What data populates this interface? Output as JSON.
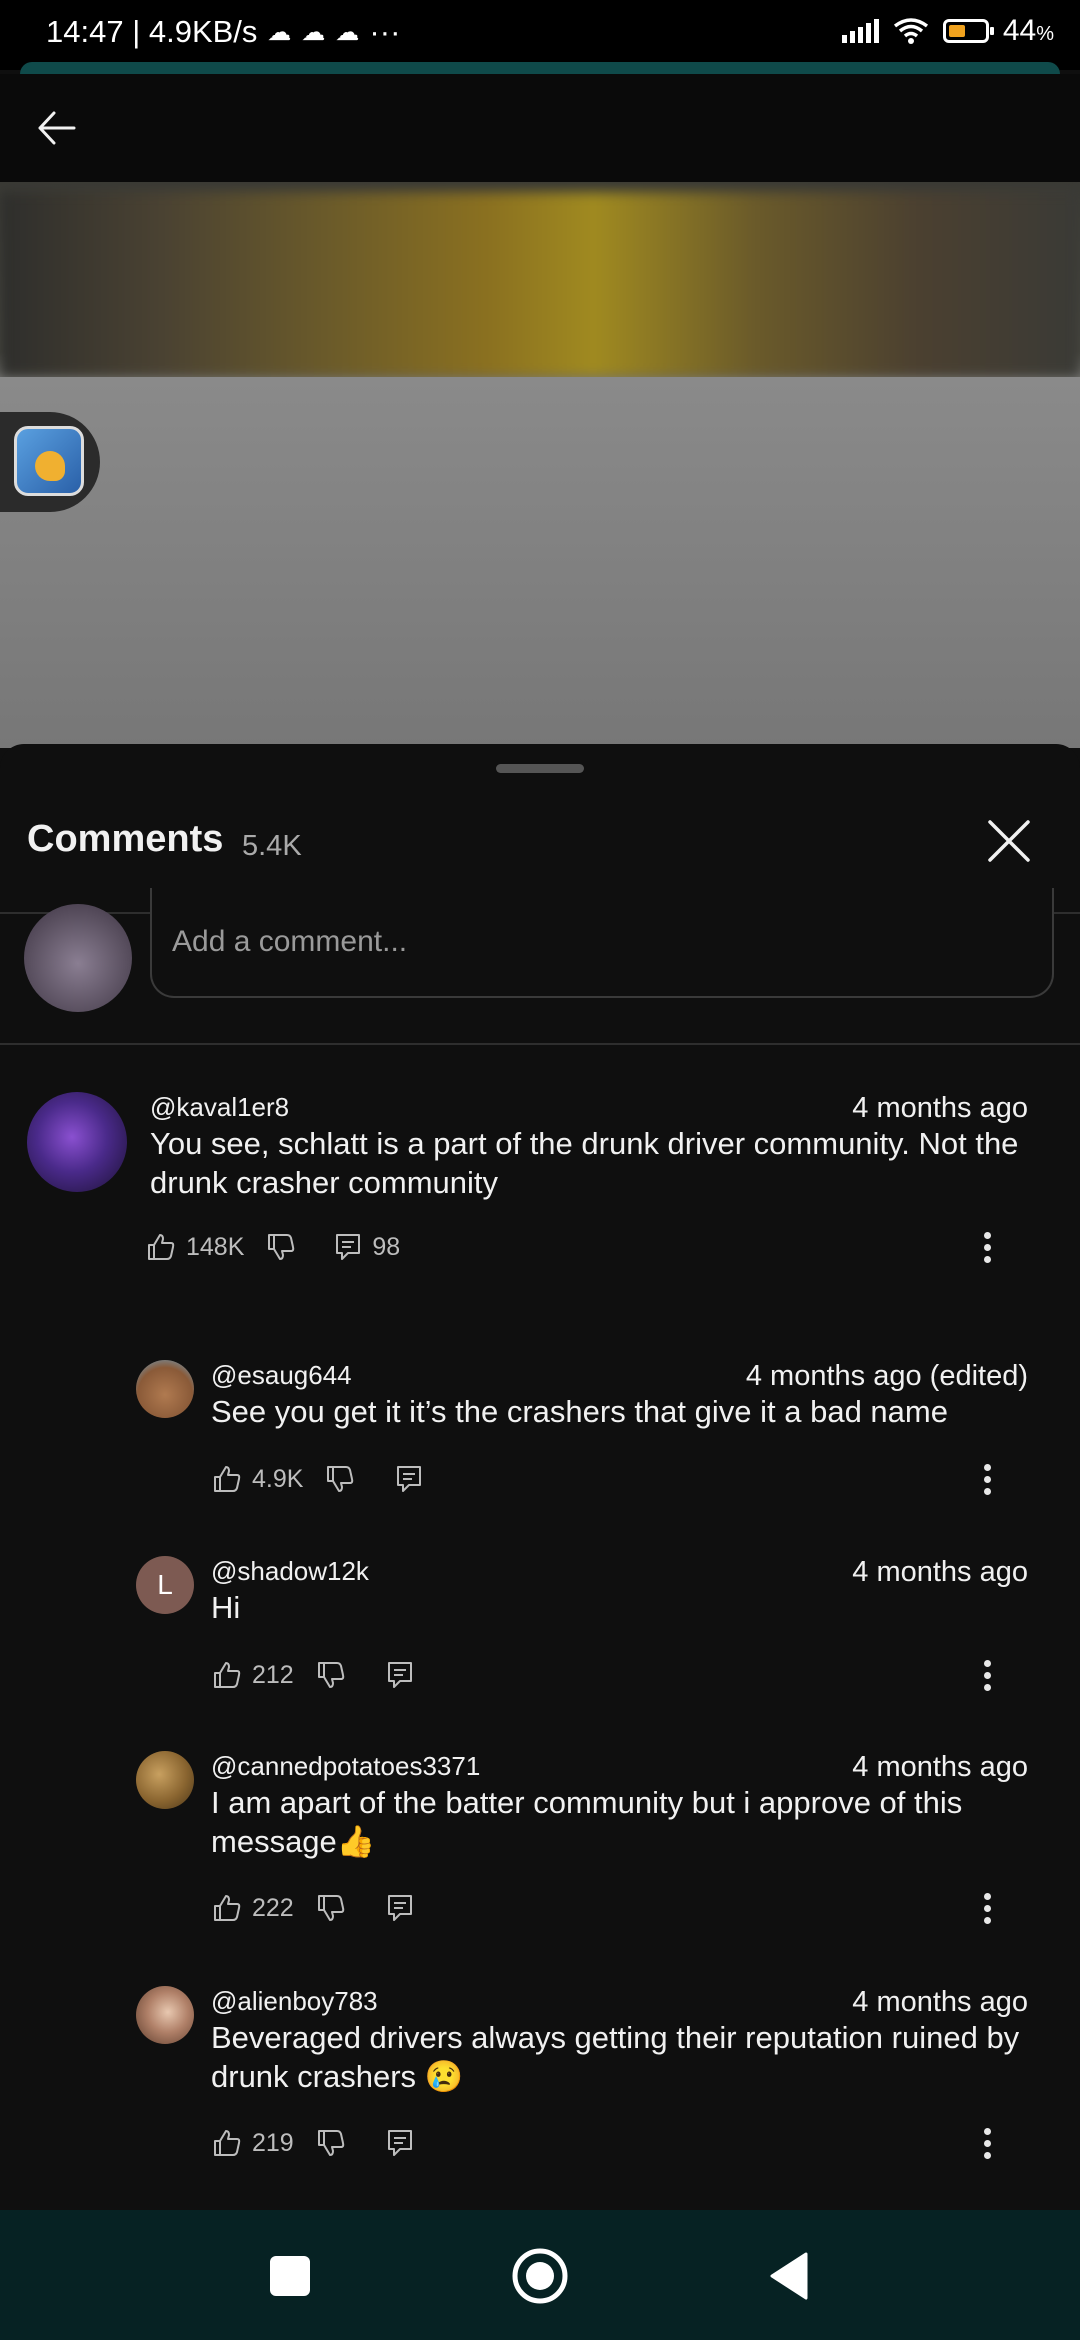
{
  "status_bar": {
    "time_speed": "14:47 | 4.9KB/s",
    "ghost_icons": [
      "☁",
      "☁",
      "☁"
    ],
    "overflow": "···",
    "battery": "44",
    "battery_unit": "%"
  },
  "sheet": {
    "title": "Comments",
    "count": "5.4K",
    "input_placeholder": "Add a comment..."
  },
  "comments": [
    {
      "author": "@kaval1er8",
      "time": "4 months ago",
      "text": "You see, schlatt is a part of the drunk driver community. Not the drunk crasher community",
      "likes": "148K",
      "replies": "98"
    }
  ],
  "replies": [
    {
      "author": "@esaug644",
      "time": "4 months ago (edited)",
      "text": "See you get it it’s the crashers that give it a bad name",
      "likes": "4.9K"
    },
    {
      "author": "@shadow12k",
      "avatar_letter": "L",
      "time": "4 months ago",
      "text": "Hi",
      "likes": "212"
    },
    {
      "author": "@cannedpotatoes3371",
      "time": "4 months ago",
      "text": "I am apart of the batter community but i approve of this message👍",
      "likes": "222"
    },
    {
      "author": "@alienboy783",
      "time": "4 months ago",
      "text": "Beveraged drivers always getting their reputation ruined by drunk crashers 😢",
      "likes": "219"
    }
  ],
  "colors": {
    "background": "#0f0f0f",
    "nav_bar": "#062223",
    "accent_teal": "#0f4a4a"
  }
}
